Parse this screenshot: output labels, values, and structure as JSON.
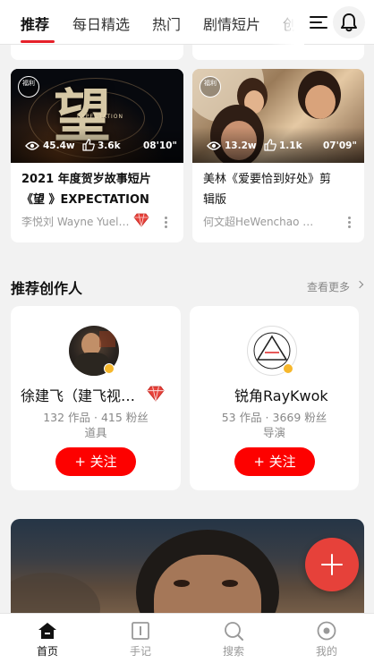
{
  "topnav": {
    "tabs": [
      {
        "label": "推荐",
        "active": true
      },
      {
        "label": "每日精选"
      },
      {
        "label": "热门"
      },
      {
        "label": "剧情短片"
      },
      {
        "label": "创意"
      }
    ],
    "accent_color": "#e6212a"
  },
  "videos": [
    {
      "title_line1": "2021 年度贺岁故事短片",
      "title_line2": "《望 》EXPECTATION",
      "author": "李悦刘 Wayne Yueli…",
      "views": "45.4w",
      "likes": "3.6k",
      "duration": "08'10\"",
      "poster_char": "望",
      "poster_sub": "EXPECTATION",
      "badge": "福利"
    },
    {
      "title_line1": "美林《爱要恰到好处》剪",
      "title_line2": "辑版",
      "author": "何文超HeWenchao …",
      "views": "13.2w",
      "likes": "1.1k",
      "duration": "07'09\"",
      "badge": "福利"
    }
  ],
  "creators_section": {
    "title": "推荐创作人",
    "more_label": "查看更多"
  },
  "creators": [
    {
      "name": "徐建飞（建飞视…",
      "stats": "132 作品 · 415 粉丝",
      "role": "道具",
      "follow_label": "+ 关注"
    },
    {
      "name": "锐角RayKwok",
      "stats": "53 作品 · 3669 粉丝",
      "role": "导演",
      "follow_label": "+ 关注"
    }
  ],
  "tabbar": {
    "items": [
      {
        "label": "首页",
        "icon": "home-icon",
        "active": true
      },
      {
        "label": "手记",
        "icon": "notebook-icon"
      },
      {
        "label": "搜索",
        "icon": "search-icon"
      },
      {
        "label": "我的",
        "icon": "profile-icon"
      }
    ]
  },
  "colors": {
    "follow_button": "#fd0100",
    "fab": "#e6413a",
    "verified_badge": "#f6b72c"
  }
}
